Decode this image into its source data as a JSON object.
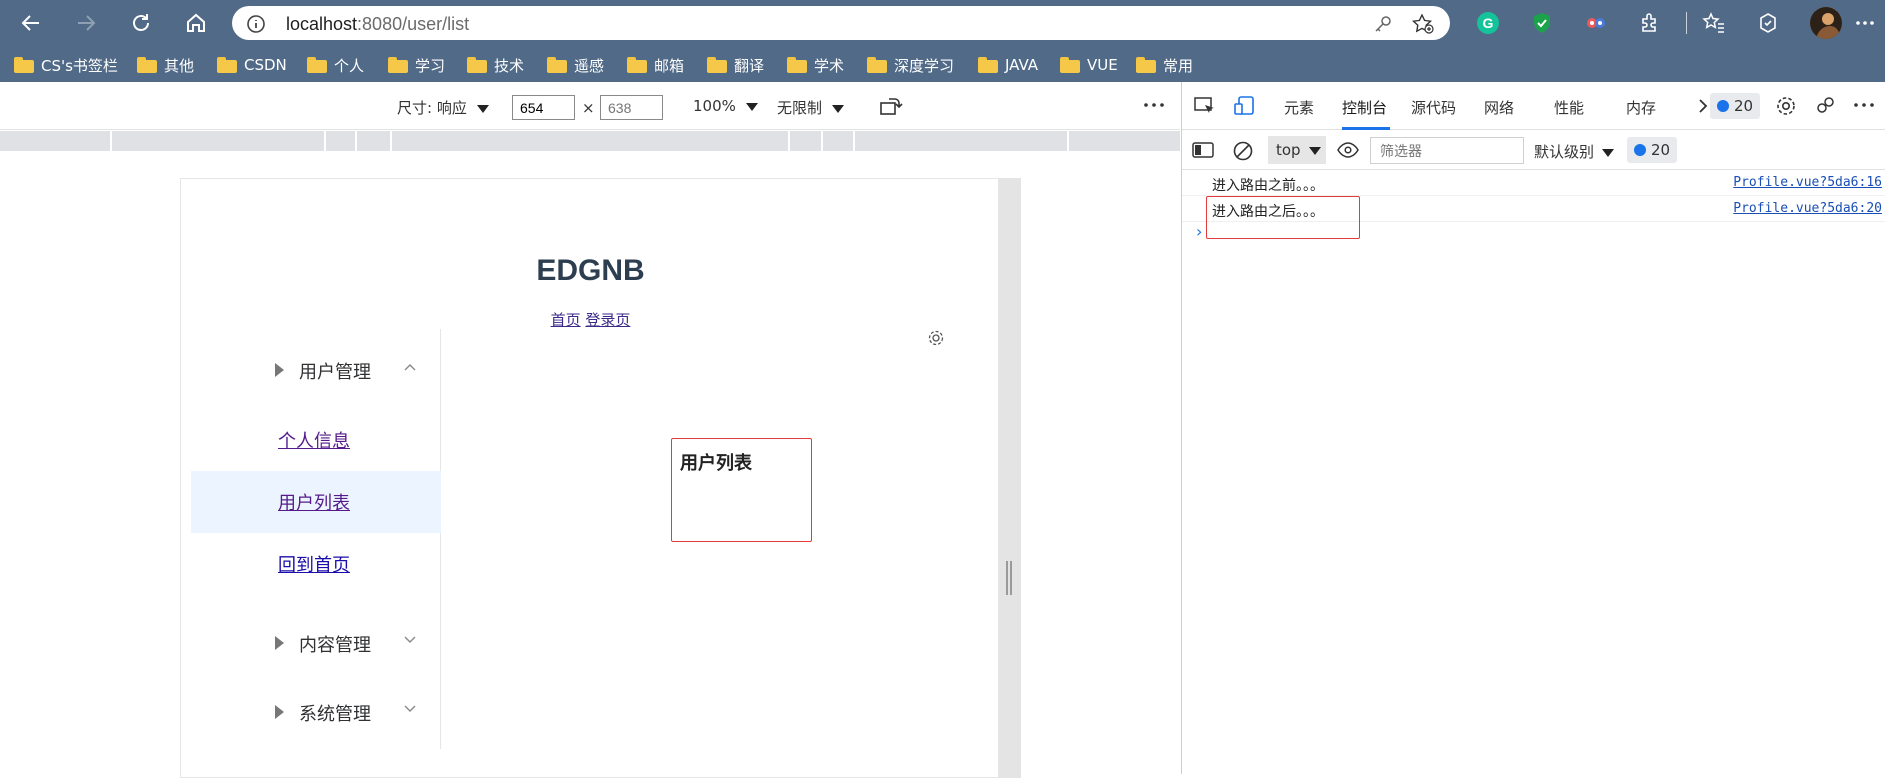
{
  "browser": {
    "url_host": "localhost",
    "url_path": ":8080/user/list",
    "bookmarks": [
      "CS's书签栏",
      "其他",
      "CSDN",
      "个人",
      "学习",
      "技术",
      "遥感",
      "邮箱",
      "翻译",
      "学术",
      "深度学习",
      "JAVA",
      "VUE",
      "常用"
    ]
  },
  "emulation": {
    "dimensions_label": "尺寸: 响应",
    "width_value": "654",
    "height_placeholder": "638",
    "times": "×",
    "zoom": "100%",
    "throttle": "无限制"
  },
  "app": {
    "title": "EDGNB",
    "links": [
      "首页",
      "登录页"
    ],
    "menu": {
      "user_group": "用户管理",
      "items": [
        "个人信息",
        "用户列表",
        "回到首页"
      ],
      "content_group": "内容管理",
      "system_group": "系统管理"
    },
    "content_heading": "用户列表"
  },
  "devtools": {
    "tabs": [
      "元素",
      "控制台",
      "源代码",
      "网络",
      "性能",
      "内存"
    ],
    "active_tab": "控制台",
    "issues_count": "20",
    "context": "top",
    "filter_placeholder": "筛选器",
    "level": "默认级别",
    "logs": [
      {
        "message": "进入路由之前。。。",
        "source": "Profile.vue?5da6:16"
      },
      {
        "message": "进入路由之后。。。",
        "source": "Profile.vue?5da6:20"
      }
    ],
    "prompt": "›"
  },
  "colors": {
    "chrome_bar": "#506a87",
    "highlight_red": "#e33b3b",
    "active_menu_bg": "#ecf5ff",
    "link_blue": "#1a4fb5"
  }
}
